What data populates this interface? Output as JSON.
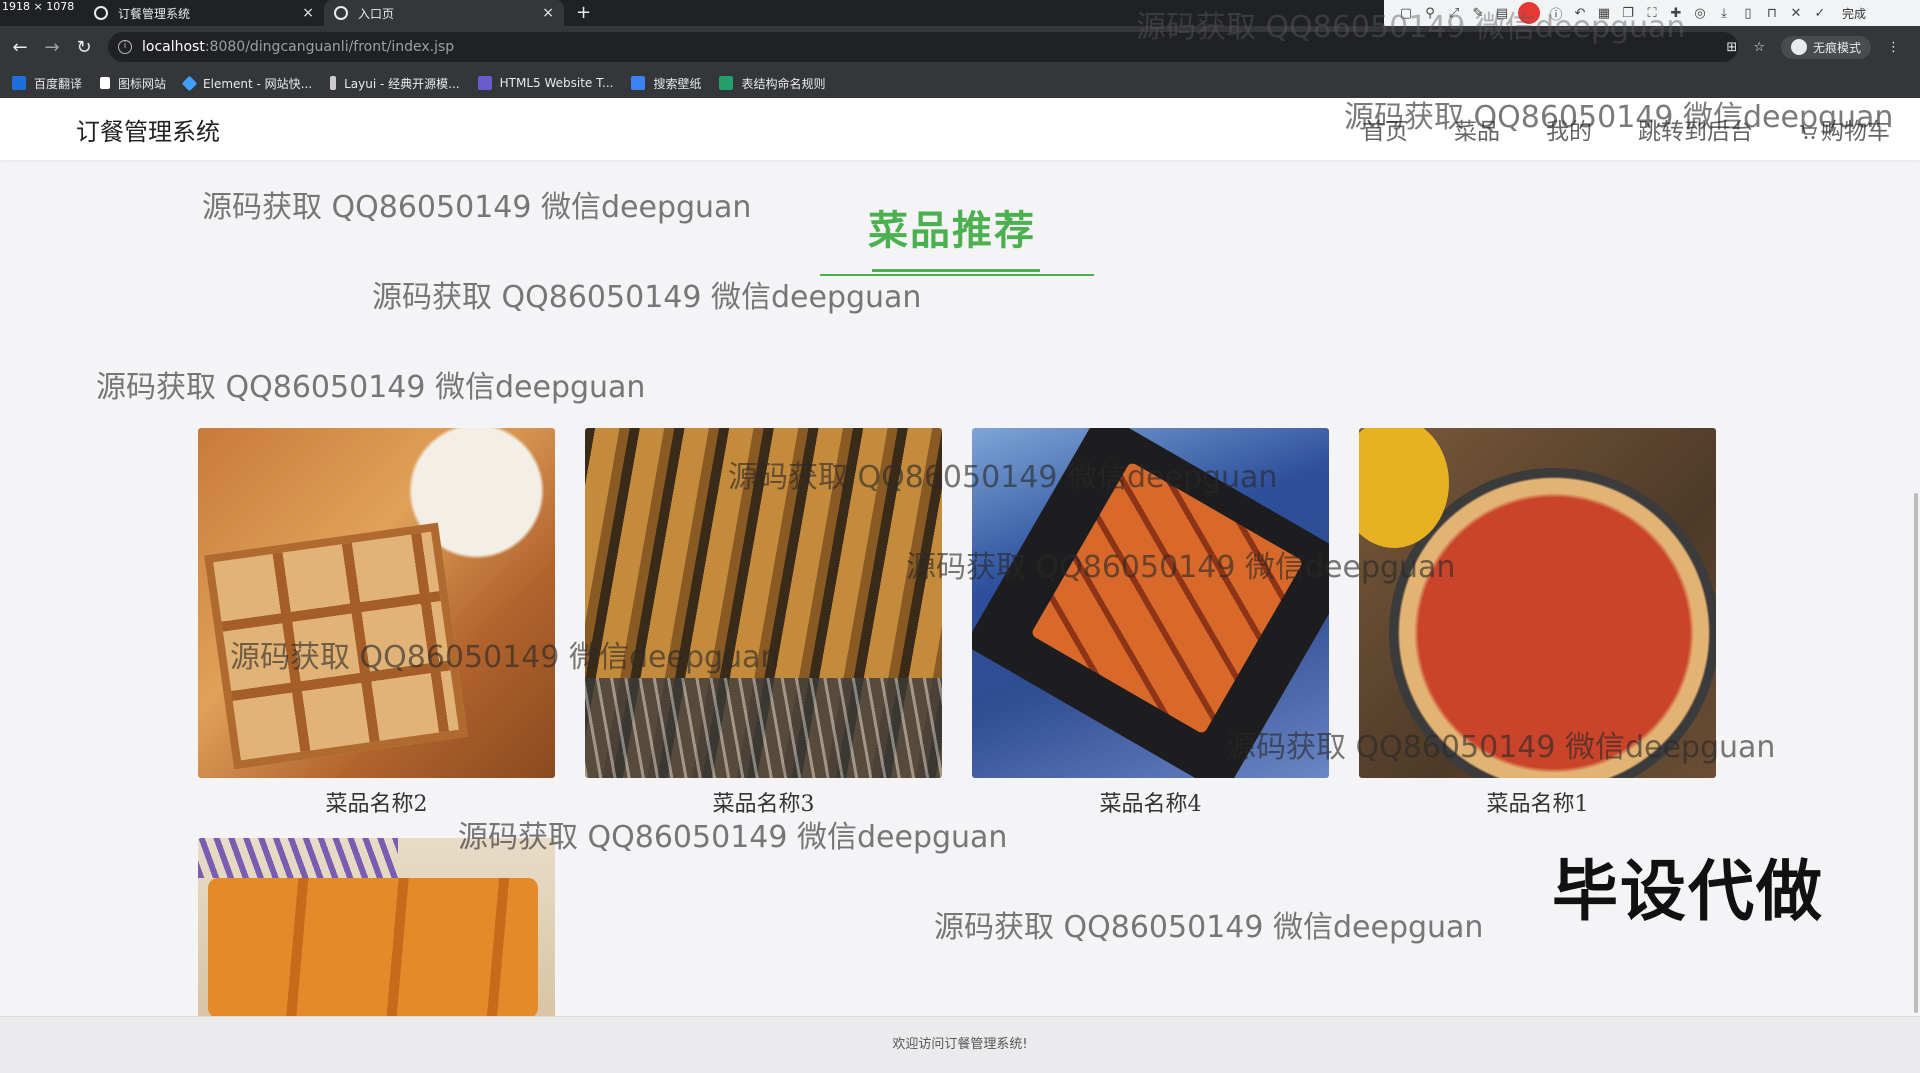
{
  "browser": {
    "dims_label": "1918 × 1078",
    "tabs": [
      {
        "label": "订餐管理系统",
        "active": false
      },
      {
        "label": "入口页",
        "active": true
      }
    ],
    "new_tab": "+",
    "close_glyph": "×",
    "ext_done_label": "完成",
    "url_host": "localhost",
    "url_path": ":8080/dingcanguanli/front/index.jsp",
    "incognito_label": "无痕模式",
    "bookmarks": [
      {
        "label": "百度翻译",
        "color": "#1e6fd9"
      },
      {
        "label": "图标网站",
        "color": "#ffffff"
      },
      {
        "label": "Element - 网站快...",
        "color": "#409eff"
      },
      {
        "label": "Layui - 经典开源模...",
        "color": "#cccccc"
      },
      {
        "label": "HTML5 Website T...",
        "color": "#6a5acd"
      },
      {
        "label": "搜索壁纸",
        "color": "#3b82f6"
      },
      {
        "label": "表结构命名规则",
        "color": "#22a06b"
      }
    ]
  },
  "site": {
    "brand": "订餐管理系统",
    "nav": [
      "首页",
      "菜品",
      "我的",
      "跳转到后台",
      "购物车"
    ],
    "section_title": "菜品推荐",
    "accent_color": "#4caf50",
    "dishes": [
      {
        "name": "菜品名称2"
      },
      {
        "name": "菜品名称3"
      },
      {
        "name": "菜品名称4"
      },
      {
        "name": "菜品名称1"
      },
      {
        "name": ""
      }
    ],
    "footer": "欢迎访问订餐管理系统!"
  },
  "overlay": {
    "watermark": "源码获取 QQ86050149 微信deepguan",
    "corner_text": "毕设代做"
  }
}
